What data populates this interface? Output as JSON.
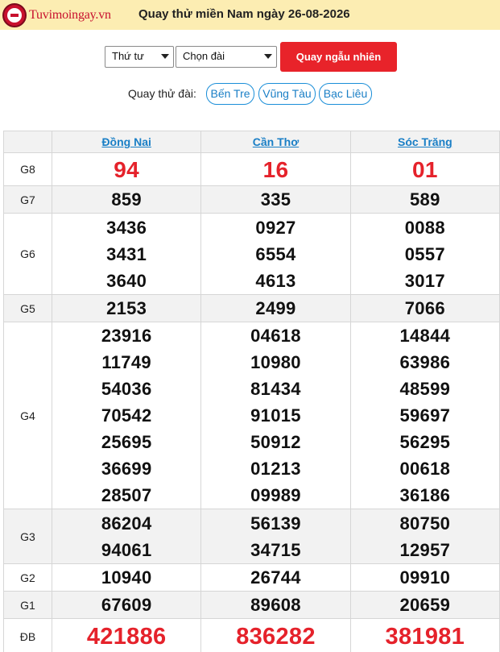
{
  "header": {
    "logo_text": "Tuvimoingay.vn",
    "title": "Quay thử miền Nam ngày 26-08-2026",
    "background": "#fcedb2"
  },
  "controls": {
    "day_select_value": "Thứ tư",
    "station_select_value": "Chọn đài",
    "spin_button_label": "Quay ngẫu nhiên",
    "spin_button_color": "#e8232a"
  },
  "quick_spin": {
    "label": "Quay thử đài:",
    "stations": [
      "Bến Tre",
      "Vũng Tàu",
      "Bạc Liêu"
    ]
  },
  "results": {
    "provinces": [
      "Đồng Nai",
      "Cần Thơ",
      "Sóc Trăng"
    ],
    "prizes": [
      {
        "label": "G8",
        "values": [
          [
            "94"
          ],
          [
            "16"
          ],
          [
            "01"
          ]
        ]
      },
      {
        "label": "G7",
        "values": [
          [
            "859"
          ],
          [
            "335"
          ],
          [
            "589"
          ]
        ]
      },
      {
        "label": "G6",
        "values": [
          [
            "3436",
            "3431",
            "3640"
          ],
          [
            "0927",
            "6554",
            "4613"
          ],
          [
            "0088",
            "0557",
            "3017"
          ]
        ]
      },
      {
        "label": "G5",
        "values": [
          [
            "2153"
          ],
          [
            "2499"
          ],
          [
            "7066"
          ]
        ]
      },
      {
        "label": "G4",
        "values": [
          [
            "23916",
            "11749",
            "54036",
            "70542",
            "25695",
            "36699",
            "28507"
          ],
          [
            "04618",
            "10980",
            "81434",
            "91015",
            "50912",
            "01213",
            "09989"
          ],
          [
            "14844",
            "63986",
            "48599",
            "59697",
            "56295",
            "00618",
            "36186"
          ]
        ]
      },
      {
        "label": "G3",
        "values": [
          [
            "86204",
            "94061"
          ],
          [
            "56139",
            "34715"
          ],
          [
            "80750",
            "12957"
          ]
        ]
      },
      {
        "label": "G2",
        "values": [
          [
            "10940"
          ],
          [
            "26744"
          ],
          [
            "09910"
          ]
        ]
      },
      {
        "label": "G1",
        "values": [
          [
            "67609"
          ],
          [
            "89608"
          ],
          [
            "20659"
          ]
        ]
      },
      {
        "label": "ĐB",
        "values": [
          [
            "421886"
          ],
          [
            "836282"
          ],
          [
            "381981"
          ]
        ]
      }
    ],
    "highlight_color": "#e5222b"
  }
}
